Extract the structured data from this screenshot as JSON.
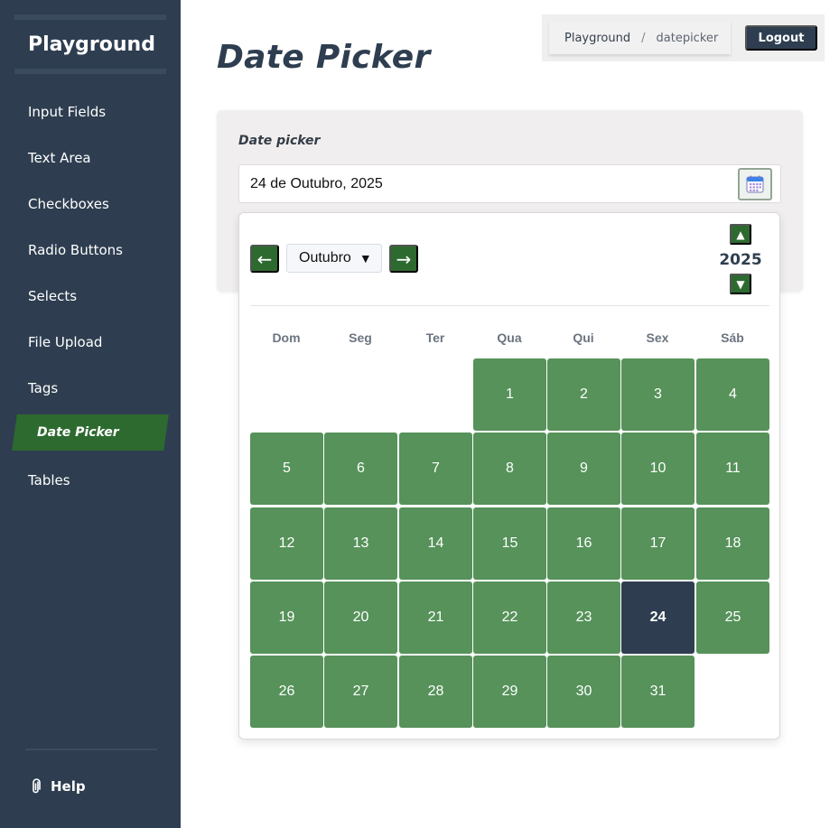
{
  "sidebar": {
    "brand": "Playground",
    "items": [
      {
        "label": "Input Fields"
      },
      {
        "label": "Text Area"
      },
      {
        "label": "Checkboxes"
      },
      {
        "label": "Radio Buttons"
      },
      {
        "label": "Selects"
      },
      {
        "label": "File Upload"
      },
      {
        "label": "Tags"
      },
      {
        "label": "Date Picker",
        "active": true
      },
      {
        "label": "Tables"
      }
    ],
    "help_label": "Help"
  },
  "header": {
    "breadcrumb": [
      "Playground",
      "datepicker"
    ],
    "breadcrumb_separator": "/",
    "logout_label": "Logout"
  },
  "main": {
    "title": "Date Picker",
    "field_label": "Date picker",
    "date_value": "24 de Outubro, 2025"
  },
  "calendar": {
    "prev_label": "←",
    "next_label": "→",
    "month": "Outubro",
    "month_caret": "▼",
    "year": "2025",
    "year_up": "▲",
    "year_down": "▼",
    "weekdays": [
      "Dom",
      "Seg",
      "Ter",
      "Qua",
      "Qui",
      "Sex",
      "Sáb"
    ],
    "first_weekday_index": 3,
    "days_in_month": 31,
    "selected_day": 24
  },
  "colors": {
    "sidebar_bg": "#2e3e50",
    "accent_green": "#2d6a2f",
    "day_green": "#56925a",
    "selected_day": "#2e3e50"
  }
}
